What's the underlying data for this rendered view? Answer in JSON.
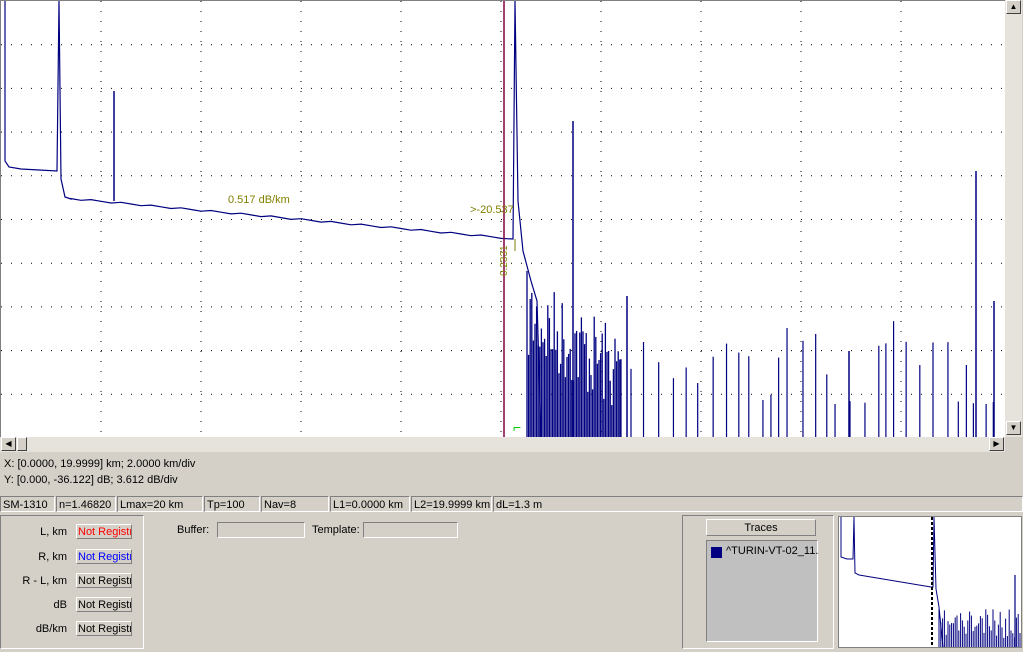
{
  "colors": {
    "trace": "#000080",
    "cursor": "#800040",
    "annotation": "#808000",
    "marker": "#00cc00",
    "l_value": "#ff0000",
    "r_value": "#0000ff"
  },
  "plot": {
    "slope_label": "0.517 dB/km",
    "level_label": ">-20.537",
    "cursor_value_label": "0.2331"
  },
  "info": {
    "x_line": "X: [0.0000, 19.9999] km; 2.0000 km/div",
    "y_line": "Y: [0.000, -36.122] dB; 3.612 dB/div"
  },
  "status": [
    "SM-1310",
    "n=1.46820",
    "Lmax=20 km",
    "Tp=100",
    "Nav=8",
    "L1=0.0000 km",
    "L2=19.9999 km",
    "dL=1.3 m"
  ],
  "results": {
    "rows": [
      {
        "label": "L, km",
        "value": "Not Registr"
      },
      {
        "label": "R, km",
        "value": "Not Registr"
      },
      {
        "label": "R - L, km",
        "value": "Not Registr"
      },
      {
        "label": "dB",
        "value": "Not Registr"
      },
      {
        "label": "dB/km",
        "value": "Not Registr"
      }
    ]
  },
  "buffer_label": "Buffer:",
  "template_label": "Template:",
  "traces": {
    "header": "Traces",
    "items": [
      "^TURIN-VT-02_11."
    ]
  },
  "icons": {
    "scroll_left": "arrow-left-icon",
    "scroll_right": "arrow-right-icon",
    "scroll_up": "arrow-up-icon",
    "scroll_down": "arrow-down-icon",
    "marker": "cursor-marker-icon"
  }
}
